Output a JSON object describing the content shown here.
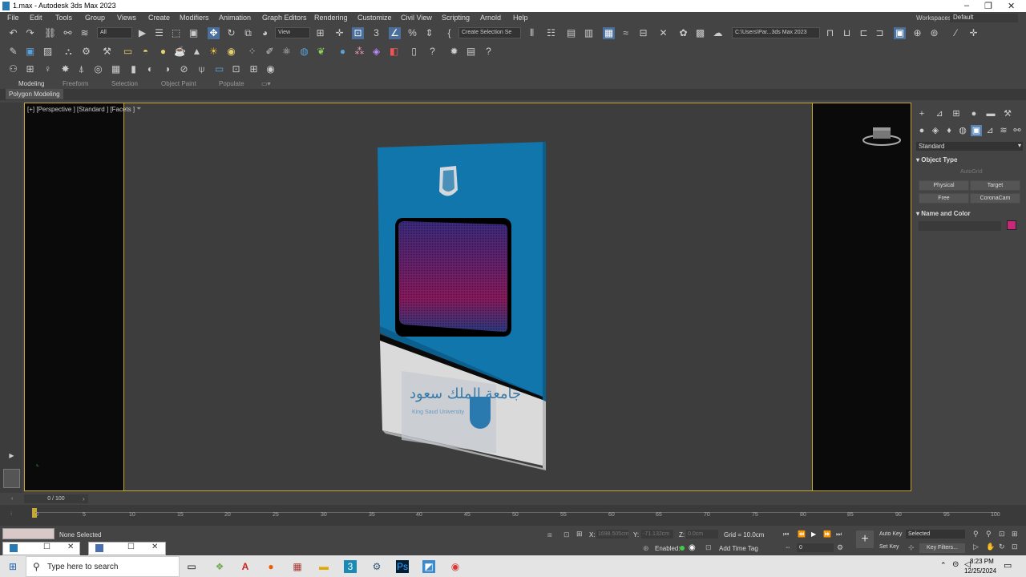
{
  "titlebar": {
    "title": "1.max - Autodesk 3ds Max 2023"
  },
  "menu": {
    "items": [
      "File",
      "Edit",
      "Tools",
      "Group",
      "Views",
      "Create",
      "Modifiers",
      "Animation",
      "Graph Editors",
      "Rendering",
      "Customize",
      "Civil View",
      "Scripting",
      "Arnold",
      "Help"
    ],
    "workspaces_label": "Workspaces:",
    "workspaces_value": "Default"
  },
  "toolbar": {
    "selection_filter": "All",
    "coord_system": "View",
    "named_selection": "Create Selection Se",
    "project_path": "C:\\Users\\Par...3ds Max 2023"
  },
  "ribbon": {
    "tabs": [
      "Modeling",
      "Freeform",
      "Selection",
      "Object Paint",
      "Populate"
    ],
    "sub_label": "Polygon Modeling"
  },
  "viewport": {
    "label": "[+] [Perspective ] [Standard ] [Facets ]",
    "logo_arabic": "جامعة الملك سعود",
    "logo_english": "King Saud University"
  },
  "command_panel": {
    "category": "Standard",
    "object_type_title": "Object Type",
    "autogrid": "AutoGrid",
    "buttons": [
      "Physical",
      "Target",
      "Free",
      "CoronaCam"
    ],
    "name_color_title": "Name and Color",
    "swatch_color": "#c8287a"
  },
  "time": {
    "frame_display": "0 / 100",
    "ticks": [
      "0",
      "5",
      "10",
      "15",
      "20",
      "25",
      "30",
      "35",
      "40",
      "45",
      "50",
      "55",
      "60",
      "65",
      "70",
      "75",
      "80",
      "85",
      "90",
      "95",
      "100"
    ]
  },
  "status": {
    "selection": "None Selected",
    "x_label": "X:",
    "x_value": "1698.505cm",
    "y_label": "Y:",
    "y_value": "-71.132cm",
    "z_label": "Z:",
    "z_value": "0.0cm",
    "grid": "Grid = 10.0cm",
    "enabled": "Enabled:",
    "add_time_tag": "Add Time Tag",
    "auto_key": "Auto Key",
    "selected": "Selected",
    "set_key": "Set Key",
    "key_filters": "Key Filters...",
    "current_frame": "0"
  },
  "taskbar": {
    "search": "Type here to search",
    "time": "8:23 PM",
    "date": "12/25/2024"
  }
}
